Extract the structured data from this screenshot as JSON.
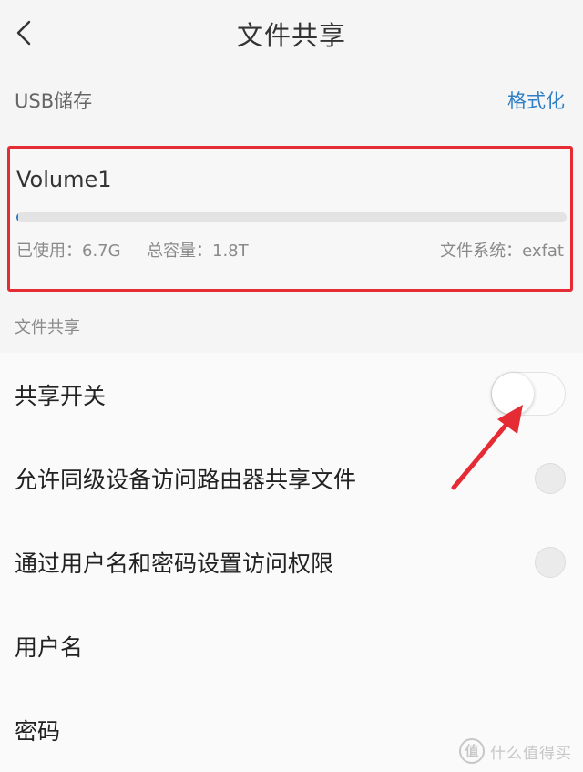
{
  "header": {
    "title": "文件共享",
    "back_icon": "chevron-left-icon"
  },
  "usb": {
    "label": "USB储存",
    "format_label": "格式化"
  },
  "volume": {
    "name": "Volume1",
    "used_text": "已使用：6.7G",
    "total_text": "总容量：1.8T",
    "filesystem_text": "文件系统：exfat",
    "usage_fraction": 0.004
  },
  "section": {
    "label": "文件共享"
  },
  "settings": {
    "share_switch": {
      "label": "共享开关",
      "state": "off"
    },
    "allow_peer_access": {
      "label": "允许同级设备访问路由器共享文件",
      "checked": false
    },
    "auth_access": {
      "label": "通过用户名和密码设置访问权限",
      "checked": false
    },
    "username": {
      "label": "用户名"
    },
    "password": {
      "label": "密码"
    }
  },
  "colors": {
    "accent": "#2f7fc6",
    "highlight_red": "#e52b33"
  }
}
